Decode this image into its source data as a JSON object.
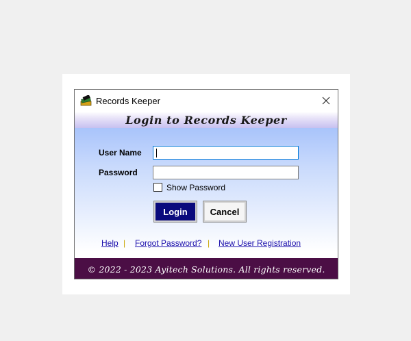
{
  "window": {
    "title": "Records Keeper",
    "app_icon": "records-keeper-app-icon",
    "close_icon": "close-icon"
  },
  "banner": {
    "heading": "Login to Records Keeper"
  },
  "form": {
    "username_label": "User Name",
    "username_value": "",
    "password_label": "Password",
    "password_value": "",
    "show_password_label": "Show Password",
    "show_password_checked": false
  },
  "buttons": {
    "login": "Login",
    "cancel": "Cancel"
  },
  "links": {
    "help": "Help",
    "separator": "|",
    "forgot_password": "Forgot Password?",
    "new_user": "New User Registration"
  },
  "footer": {
    "copyright": "© 2022 - 2023 Ayitech Solutions. All rights reserved."
  },
  "colors": {
    "banner_gradient_end": "#c7c0f0",
    "form_gradient_top": "#a9c4fb",
    "login_button_bg": "#0a0a7d",
    "footer_bg": "#4b0e45",
    "link_color": "#1a0dab",
    "separator_color": "#c8a400"
  }
}
